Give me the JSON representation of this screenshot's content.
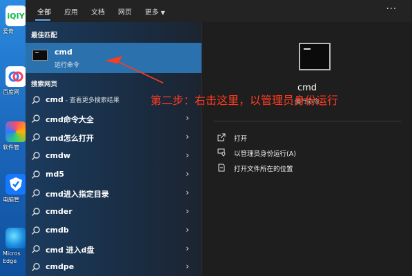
{
  "desktop": {
    "icons": [
      {
        "label": "爱奇",
        "tile_text": "iQIY",
        "icon": "iqiyi-icon"
      },
      {
        "label": "百度网",
        "icon": "baidu-netdisk-icon"
      },
      {
        "label": "软件管",
        "icon": "software-manager-icon"
      },
      {
        "label": "电脑管",
        "icon": "pc-manager-icon"
      },
      {
        "label": "Micros Edge",
        "icon": "edge-icon"
      }
    ]
  },
  "menu": {
    "tabs": [
      {
        "label": "全部",
        "active": true
      },
      {
        "label": "应用"
      },
      {
        "label": "文档"
      },
      {
        "label": "网页"
      },
      {
        "label": "更多"
      }
    ],
    "more_caret": "▼",
    "options_label": "···",
    "best_match_title": "最佳匹配",
    "best_match": {
      "name": "cmd",
      "subtitle": "运行命令"
    },
    "search_web_title": "搜索网页",
    "results": [
      {
        "label": "cmd",
        "sub": " - 查看更多搜索结果"
      },
      {
        "label": "cmd命令大全",
        "sub": ""
      },
      {
        "label": "cmd怎么打开",
        "sub": ""
      },
      {
        "label": "cmdw",
        "sub": ""
      },
      {
        "label": "md5",
        "sub": ""
      },
      {
        "label": "cmd进入指定目录",
        "sub": ""
      },
      {
        "label": "cmder",
        "sub": ""
      },
      {
        "label": "cmdb",
        "sub": ""
      },
      {
        "label": "cmd 进入d盘",
        "sub": ""
      },
      {
        "label": "cmdpe",
        "sub": ""
      }
    ],
    "chevron": "›"
  },
  "preview": {
    "title": "cmd",
    "subtitle": "运行命令",
    "actions": [
      {
        "label": "打开",
        "icon": "open-icon"
      },
      {
        "label": "以管理员身份运行(A)",
        "icon": "run-as-admin-icon"
      },
      {
        "label": "打开文件所在的位置",
        "icon": "open-file-location-icon"
      }
    ]
  },
  "annotation": {
    "text": "第二步：右击这里，以管理员身份运行",
    "color": "#ff3b1f"
  },
  "colors": {
    "highlight": "#2b71ad",
    "accent": "#5ea8ff",
    "panel": "#1d1d1d"
  }
}
